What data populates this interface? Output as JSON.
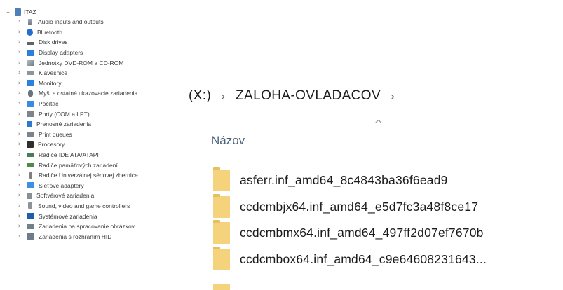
{
  "device_manager": {
    "root": {
      "label": "ITAZ",
      "chevron": "⌄",
      "icon": "computer-icon"
    },
    "items": [
      {
        "label": "Audio inputs and outputs",
        "icon": "audio-icon",
        "cls": "i-audio"
      },
      {
        "label": "Bluetooth",
        "icon": "bluetooth-icon",
        "cls": "i-bt"
      },
      {
        "label": "Disk drives",
        "icon": "disk-drive-icon",
        "cls": "i-disk"
      },
      {
        "label": "Display adapters",
        "icon": "display-adapter-icon",
        "cls": "i-display"
      },
      {
        "label": "Jednotky DVD-ROM a CD-ROM",
        "icon": "dvd-drive-icon",
        "cls": "i-dvd"
      },
      {
        "label": "Klávesnice",
        "icon": "keyboard-icon",
        "cls": "i-kbd"
      },
      {
        "label": "Monitory",
        "icon": "monitor-icon",
        "cls": "i-monitor"
      },
      {
        "label": "Myši a ostatné ukazovacie zariadenia",
        "icon": "mouse-icon",
        "cls": "i-mouse"
      },
      {
        "label": "Počítač",
        "icon": "computer-icon",
        "cls": "i-pc"
      },
      {
        "label": "Porty (COM a LPT)",
        "icon": "port-icon",
        "cls": "i-port"
      },
      {
        "label": "Prenosné zariadenia",
        "icon": "portable-device-icon",
        "cls": "i-port2"
      },
      {
        "label": "Print queues",
        "icon": "printer-icon",
        "cls": "i-print"
      },
      {
        "label": "Procesory",
        "icon": "processor-icon",
        "cls": "i-cpu"
      },
      {
        "label": "Radiče IDE ATA/ATAPI",
        "icon": "ide-controller-icon",
        "cls": "i-ide"
      },
      {
        "label": "Radiče pamäťových zariadení",
        "icon": "storage-controller-icon",
        "cls": "i-mem"
      },
      {
        "label": "Radiče Univerzálnej sériovej zbernice",
        "icon": "usb-icon",
        "cls": "i-usb"
      },
      {
        "label": "Sieťové adaptéry",
        "icon": "network-adapter-icon",
        "cls": "i-net"
      },
      {
        "label": "Softvérové zariadenia",
        "icon": "software-device-icon",
        "cls": "i-soft"
      },
      {
        "label": "Sound, video and game controllers",
        "icon": "sound-icon",
        "cls": "i-sound"
      },
      {
        "label": "Systémové zariadenia",
        "icon": "system-device-icon",
        "cls": "i-sys"
      },
      {
        "label": "Zariadenia na spracovanie obrázkov",
        "icon": "imaging-device-icon",
        "cls": "i-img"
      },
      {
        "label": "Zariadenia s rozhraním HID",
        "icon": "hid-icon",
        "cls": "i-hid"
      }
    ],
    "chevron_collapsed": "›"
  },
  "explorer": {
    "address": {
      "drive": "(X:)",
      "folder": "ZALOHA-OVLADACOV",
      "separator": "›"
    },
    "sort_caret": "^",
    "column_name": "Názov",
    "files": [
      "asferr.inf_amd64_8c4843ba36f6ead9",
      "ccdcmbjx64.inf_amd64_e5d7fc3a48f8ce17",
      "ccdcmbmx64.inf_amd64_497ff2d07ef7670b",
      "ccdcmbox64.inf_amd64_c9e64608231643..."
    ],
    "folder_icon": "folder-icon"
  }
}
